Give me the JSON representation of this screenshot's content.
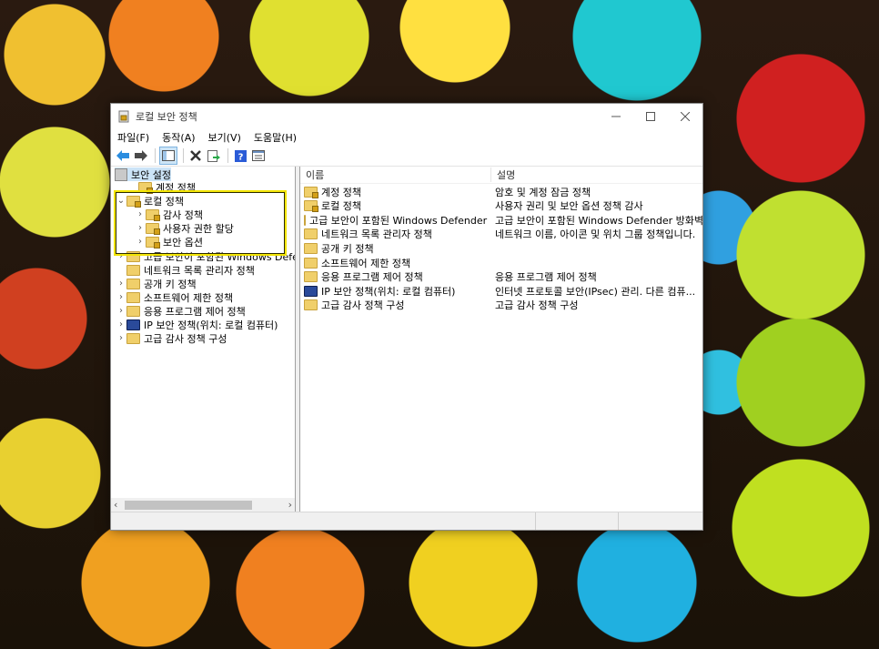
{
  "window": {
    "title": "로컬 보안 정책"
  },
  "menu": [
    "파일(F)",
    "동작(A)",
    "보기(V)",
    "도움말(H)"
  ],
  "tree": {
    "root": "보안 설정",
    "items": [
      {
        "label": "계정 정책",
        "indent": 1,
        "expander": ""
      },
      {
        "label": "로컬 정책",
        "indent": 0,
        "expander": "⌄"
      },
      {
        "label": "감사 정책",
        "indent": 1,
        "expander": "›"
      },
      {
        "label": "사용자 권한 할당",
        "indent": 1,
        "expander": "›"
      },
      {
        "label": "보안 옵션",
        "indent": 1,
        "expander": "›"
      },
      {
        "label": "고급 보안이 포함된 Windows Defende",
        "indent": 0,
        "expander": "›"
      },
      {
        "label": "네트워크 목록 관리자 정책",
        "indent": 0,
        "expander": ""
      },
      {
        "label": "공개 키 정책",
        "indent": 0,
        "expander": "›"
      },
      {
        "label": "소프트웨어 제한 정책",
        "indent": 0,
        "expander": "›"
      },
      {
        "label": "응용 프로그램 제어 정책",
        "indent": 0,
        "expander": "›"
      },
      {
        "label": "IP 보안 정책(위치: 로컬 컴퓨터)",
        "indent": 0,
        "expander": "›"
      },
      {
        "label": "고급 감사 정책 구성",
        "indent": 0,
        "expander": "›"
      }
    ]
  },
  "list": {
    "columns": [
      "이름",
      "설명"
    ],
    "rows": [
      {
        "name": "계정 정책",
        "desc": "암호 및 계정 잠금 정책"
      },
      {
        "name": "로컬 정책",
        "desc": "사용자 권리 및 보안 옵션 정책 감사"
      },
      {
        "name": "고급 보안이 포함된 Windows Defender ...",
        "desc": "고급 보안이 포함된 Windows Defender 방화벽"
      },
      {
        "name": "네트워크 목록 관리자 정책",
        "desc": "네트워크 이름, 아이콘 및 위치 그룹 정책입니다."
      },
      {
        "name": "공개 키 정책",
        "desc": ""
      },
      {
        "name": "소프트웨어 제한 정책",
        "desc": ""
      },
      {
        "name": "응용 프로그램 제어 정책",
        "desc": "응용 프로그램 제어 정책"
      },
      {
        "name": "IP 보안 정책(위치: 로컬 컴퓨터)",
        "desc": "인터넷 프로토콜 보안(IPsec) 관리. 다른 컴퓨..."
      },
      {
        "name": "고급 감사 정책 구성",
        "desc": "고급 감사 정책 구성"
      }
    ]
  }
}
